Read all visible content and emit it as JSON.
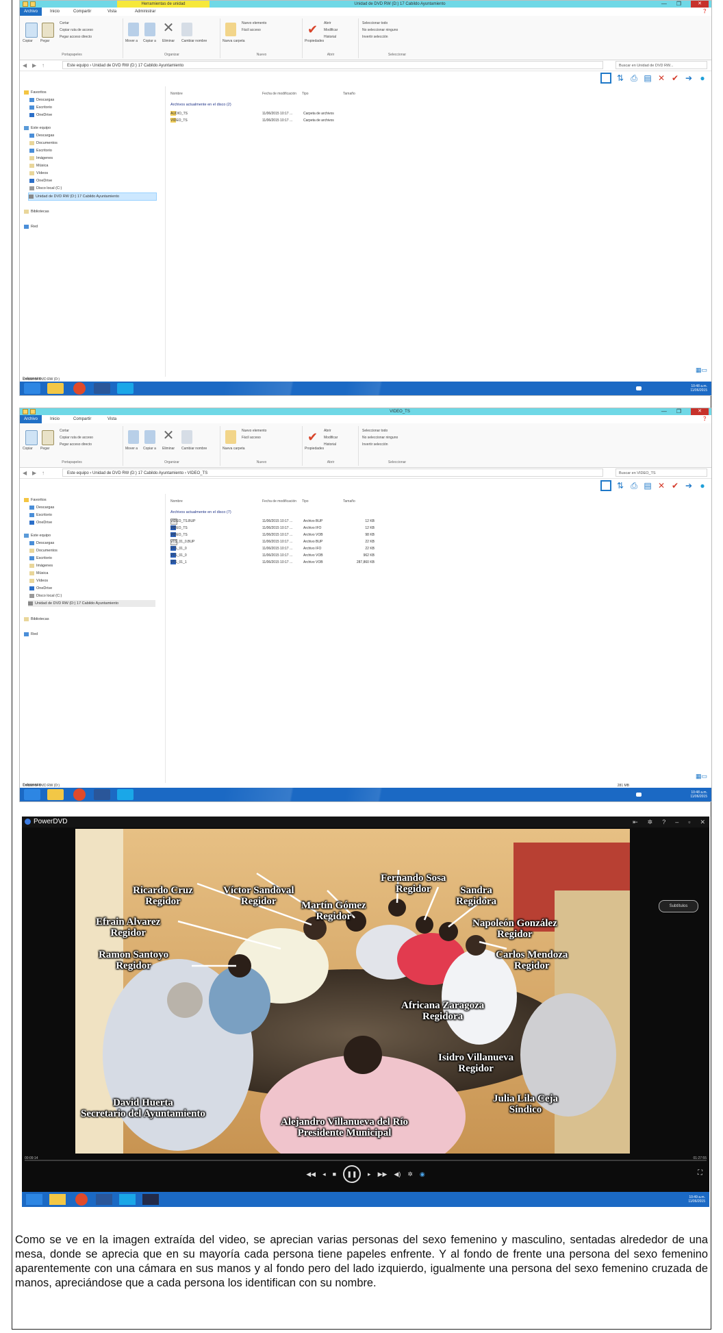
{
  "explorer1": {
    "titlebar_title": "Unidad de DVD RW (D:) 17 Cabildo Ayuntamiento",
    "context_tab": "Herramientas de unidad",
    "tabs": [
      "Archivo",
      "Inicio",
      "Compartir",
      "Vista",
      "Administrar"
    ],
    "ribbon_groups": [
      "Portapapeles",
      "Organizar",
      "Nuevo",
      "Abrir",
      "Seleccionar"
    ],
    "ribbon_items": [
      "Copiar",
      "Pegar",
      "Cortar",
      "Copiar ruta de acceso",
      "Pegar acceso directo",
      "Mover a",
      "Copiar a",
      "Eliminar",
      "Cambiar nombre",
      "Nueva carpeta",
      "Nuevo elemento",
      "Fácil acceso",
      "Propiedades",
      "Abrir",
      "Modificar",
      "Historial",
      "Seleccionar todo",
      "No seleccionar ninguno",
      "Invertir selección"
    ],
    "address_path": "Este equipo › Unidad de DVD RW (D:) 17 Cabildo Ayuntamiento",
    "search_placeholder": "Buscar en Unidad de DVD RW...",
    "nav_favorites": "Favoritos",
    "nav_fav_items": [
      "Descargas",
      "Escritorio",
      "OneDrive"
    ],
    "nav_thispc": "Este equipo",
    "nav_pc_items": [
      "Descargas",
      "Documentos",
      "Escritorio",
      "Imágenes",
      "Música",
      "Vídeos",
      "OneDrive",
      "Disco local (C:)"
    ],
    "nav_selected": "Unidad de DVD RW (D:) 17 Cabildo Ayuntamiento",
    "nav_libraries": "Bibliotecas",
    "nav_network": "Red",
    "columns": [
      "Nombre",
      "Fecha de modificación",
      "Tipo",
      "Tamaño"
    ],
    "group_header": "Archivos actualmente en el disco (2)",
    "rows": [
      {
        "name": "AUDIO_TS",
        "date": "11/06/2015 10:17 ...",
        "type": "Carpeta de archivos",
        "size": ""
      },
      {
        "name": "VIDEO_TS",
        "date": "11/06/2015 10:17 ...",
        "type": "Carpeta de archivos",
        "size": ""
      }
    ],
    "status_left": "2 elementos",
    "status_detail": "Unidad de DVD RW (D:)",
    "tray_clock": "10:48 a.m.",
    "tray_date": "11/06/2015"
  },
  "explorer2": {
    "titlebar_title": "VIDEO_TS",
    "tabs": [
      "Archivo",
      "Inicio",
      "Compartir",
      "Vista"
    ],
    "address_path": "Este equipo › Unidad de DVD RW (D:) 17 Cabildo Ayuntamiento › VIDEO_TS",
    "search_placeholder": "Buscar en VIDEO_TS",
    "columns": [
      "Nombre",
      "Fecha de modificación",
      "Tipo",
      "Tamaño"
    ],
    "group_header": "Archivos actualmente en el disco (7)",
    "rows": [
      {
        "name": "VIDEO_TS.BUP",
        "date": "11/06/2015 10:17 ...",
        "type": "Archivo BUP",
        "size": "12 KB"
      },
      {
        "name": "VIDEO_TS",
        "date": "11/06/2015 10:17 ...",
        "type": "Archivo IFO",
        "size": "12 KB"
      },
      {
        "name": "VIDEO_TS",
        "date": "11/06/2015 10:17 ...",
        "type": "Archivo VOB",
        "size": "98 KB"
      },
      {
        "name": "VTS_01_0.BUP",
        "date": "11/06/2015 10:17 ...",
        "type": "Archivo BUP",
        "size": "22 KB"
      },
      {
        "name": "VTS_01_0",
        "date": "11/06/2015 10:17 ...",
        "type": "Archivo IFO",
        "size": "22 KB"
      },
      {
        "name": "VTS_01_0",
        "date": "11/06/2015 10:17 ...",
        "type": "Archivo VOB",
        "size": "962 KB"
      },
      {
        "name": "VTS_01_1",
        "date": "11/06/2015 10:17 ...",
        "type": "Archivo VOB",
        "size": "287,860 KB"
      }
    ],
    "status_left": "7 elementos",
    "status_detail": "Unidad de DVD RW (D:)",
    "status_size": "281 MB",
    "tray_clock": "10:48 a.m.",
    "tray_date": "11/06/2015"
  },
  "player": {
    "app_name": "PowerDVD",
    "subtitles_button": "Subtítulos",
    "time_left": "00:09:14",
    "time_right": "01:27:55",
    "labels": [
      {
        "name": "Ricardo Cruz",
        "role": "Regidor"
      },
      {
        "name": "Víctor Sandoval",
        "role": "Regidor"
      },
      {
        "name": "Martín Gómez",
        "role": "Regidor"
      },
      {
        "name": "Fernando Sosa",
        "role": "Regidor"
      },
      {
        "name": "Sandra",
        "role": "Regidora"
      },
      {
        "name": "Efrain Alvarez",
        "role": "Regidor"
      },
      {
        "name": "Napoleón González",
        "role": "Regidor"
      },
      {
        "name": "Ramon Santoyo",
        "role": "Regidor"
      },
      {
        "name": "Carlos Mendoza",
        "role": "Regidor"
      },
      {
        "name": "Africana Zaragoza",
        "role": "Regidora"
      },
      {
        "name": "Isidro Villanueva",
        "role": "Regidor"
      },
      {
        "name": "Julia Lila Ceja",
        "role": "Síndico"
      },
      {
        "name": "David Huerta",
        "role": "Secretario del Ayuntamiento"
      },
      {
        "name": "Alejandro Villanueva del Río",
        "role": "Presidente Municipal"
      }
    ],
    "tray_clock": "10:49 a.m.",
    "tray_date": "11/06/2015"
  },
  "caption": "Como se ve en la imagen extraída del video, se aprecian varias personas del sexo femenino y masculino, sentadas alrededor de una mesa, donde se aprecia que en su mayoría cada persona tiene papeles enfrente. Y al fondo de frente una persona del sexo femenino aparentemente con una cámara en sus manos y al fondo pero del lado izquierdo, igualmente una persona del sexo femenino cruzada de manos, apreciándose que a cada persona los identifican con su nombre.",
  "colors": {
    "titlebar": "#6fd8e6",
    "file_tab": "#1f6fc5",
    "taskbar": "#1b69c4",
    "close": "#c7322b",
    "selection": "#cde8ff"
  }
}
